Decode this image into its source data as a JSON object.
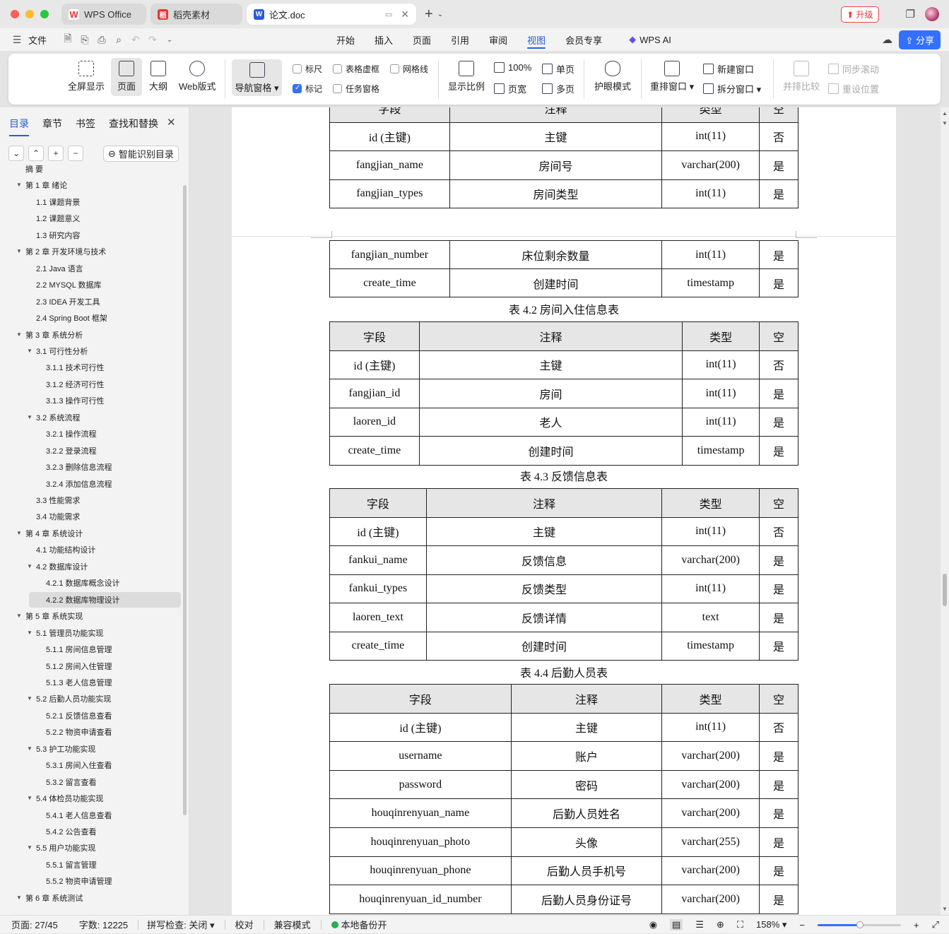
{
  "tabs": [
    {
      "label": "WPS Office"
    },
    {
      "label": "稻壳素材"
    },
    {
      "label": "论文.doc"
    }
  ],
  "title_actions": {
    "upgrade": "升级"
  },
  "menu": {
    "file": "文件",
    "items": [
      "开始",
      "插入",
      "页面",
      "引用",
      "审阅",
      "视图",
      "会员专享"
    ],
    "active": "视图",
    "ai": "WPS AI",
    "share": "分享"
  },
  "ribbon": {
    "fullscreen": "全屏显示",
    "page": "页面",
    "outline": "大纲",
    "web": "Web版式",
    "nav": "导航窗格",
    "ruler": "标尺",
    "table_grid": "表格虚框",
    "gridlines": "网格线",
    "marks": "标记",
    "taskpane": "任务窗格",
    "zoom_ratio": "显示比例",
    "zoom100": "100%",
    "page_width": "页宽",
    "single": "单页",
    "multi": "多页",
    "eye": "护眼模式",
    "rearrange": "重排窗口",
    "new_window": "新建窗口",
    "split": "拆分窗口",
    "compare": "并排比较",
    "sync_scroll": "同步滚动",
    "reset_pos": "重设位置"
  },
  "sidebar": {
    "tabs": [
      "目录",
      "章节",
      "书签",
      "查找和替换"
    ],
    "smart": "智能识别目录",
    "toc": [
      {
        "t": "摘  要",
        "lv": 1
      },
      {
        "t": "第 1 章  绪论",
        "lv": 1,
        "arrow": true
      },
      {
        "t": "1.1  课题背景",
        "lv": 2
      },
      {
        "t": "1.2  课题意义",
        "lv": 2
      },
      {
        "t": "1.3  研究内容",
        "lv": 2
      },
      {
        "t": "第 2 章  开发环境与技术",
        "lv": 1,
        "arrow": true
      },
      {
        "t": "2.1 Java 语言",
        "lv": 2
      },
      {
        "t": "2.2 MYSQL 数据库",
        "lv": 2
      },
      {
        "t": "2.3 IDEA 开发工具",
        "lv": 2
      },
      {
        "t": "2.4 Spring Boot 框架",
        "lv": 2
      },
      {
        "t": "第 3 章  系统分析",
        "lv": 1,
        "arrow": true
      },
      {
        "t": "3.1  可行性分析",
        "lv": 2,
        "arrow": true
      },
      {
        "t": "3.1.1  技术可行性",
        "lv": 3
      },
      {
        "t": "3.1.2  经济可行性",
        "lv": 3
      },
      {
        "t": "3.1.3  操作可行性",
        "lv": 3
      },
      {
        "t": "3.2  系统流程",
        "lv": 2,
        "arrow": true
      },
      {
        "t": "3.2.1  操作流程",
        "lv": 3
      },
      {
        "t": "3.2.2  登录流程",
        "lv": 3
      },
      {
        "t": "3.2.3  删除信息流程",
        "lv": 3
      },
      {
        "t": "3.2.4  添加信息流程",
        "lv": 3
      },
      {
        "t": "3.3  性能需求",
        "lv": 2
      },
      {
        "t": "3.4  功能需求",
        "lv": 2
      },
      {
        "t": "第 4 章  系统设计",
        "lv": 1,
        "arrow": true
      },
      {
        "t": "4.1  功能结构设计",
        "lv": 2
      },
      {
        "t": "4.2  数据库设计",
        "lv": 2,
        "arrow": true
      },
      {
        "t": "4.2.1  数据库概念设计",
        "lv": 3
      },
      {
        "t": "4.2.2  数据库物理设计",
        "lv": 3,
        "hl": true
      },
      {
        "t": "第 5 章  系统实现",
        "lv": 1,
        "arrow": true
      },
      {
        "t": "5.1  管理员功能实现",
        "lv": 2,
        "arrow": true
      },
      {
        "t": "5.1.1  房间信息管理",
        "lv": 3
      },
      {
        "t": "5.1.2  房间入住管理",
        "lv": 3
      },
      {
        "t": "5.1.3  老人信息管理",
        "lv": 3
      },
      {
        "t": "5.2  后勤人员功能实现",
        "lv": 2,
        "arrow": true
      },
      {
        "t": "5.2.1  反馈信息查看",
        "lv": 3
      },
      {
        "t": "5.2.2  物资申请查看",
        "lv": 3
      },
      {
        "t": "5.3  护工功能实现",
        "lv": 2,
        "arrow": true
      },
      {
        "t": "5.3.1  房间入住查看",
        "lv": 3
      },
      {
        "t": "5.3.2  留言查看",
        "lv": 3
      },
      {
        "t": "5.4  体检员功能实现",
        "lv": 2,
        "arrow": true
      },
      {
        "t": "5.4.1  老人信息查看",
        "lv": 3
      },
      {
        "t": "5.4.2  公告查看",
        "lv": 3
      },
      {
        "t": "5.5  用户功能实现",
        "lv": 2,
        "arrow": true
      },
      {
        "t": "5.5.1  留言管理",
        "lv": 3
      },
      {
        "t": "5.5.2  物资申请管理",
        "lv": 3
      },
      {
        "t": "第 6 章  系统测试",
        "lv": 1,
        "arrow": true
      }
    ]
  },
  "doc": {
    "t0_rows": [
      [
        "字段",
        "注释",
        "类型",
        "空"
      ],
      [
        "id (主键)",
        "主键",
        "int(11)",
        "否"
      ],
      [
        "fangjian_name",
        "房间号",
        "varchar(200)",
        "是"
      ],
      [
        "fangjian_types",
        "房间类型",
        "int(11)",
        "是"
      ]
    ],
    "t1_rows": [
      [
        "fangjian_number",
        "床位剩余数量",
        "int(11)",
        "是"
      ],
      [
        "create_time",
        "创建时间",
        "timestamp",
        "是"
      ]
    ],
    "cap2": "表 4.2  房间入住信息表",
    "t2_rows": [
      [
        "字段",
        "注释",
        "类型",
        "空"
      ],
      [
        "id (主键)",
        "主键",
        "int(11)",
        "否"
      ],
      [
        "fangjian_id",
        "房间",
        "int(11)",
        "是"
      ],
      [
        "laoren_id",
        "老人",
        "int(11)",
        "是"
      ],
      [
        "create_time",
        "创建时间",
        "timestamp",
        "是"
      ]
    ],
    "cap3": "表 4.3  反馈信息表",
    "t3_rows": [
      [
        "字段",
        "注释",
        "类型",
        "空"
      ],
      [
        "id (主键)",
        "主键",
        "int(11)",
        "否"
      ],
      [
        "fankui_name",
        "反馈信息",
        "varchar(200)",
        "是"
      ],
      [
        "fankui_types",
        "反馈类型",
        "int(11)",
        "是"
      ],
      [
        "laoren_text",
        "反馈详情",
        "text",
        "是"
      ],
      [
        "create_time",
        "创建时间",
        "timestamp",
        "是"
      ]
    ],
    "cap4": "表 4.4  后勤人员表",
    "t4_rows": [
      [
        "字段",
        "注释",
        "类型",
        "空"
      ],
      [
        "id (主键)",
        "主键",
        "int(11)",
        "否"
      ],
      [
        "username",
        "账户",
        "varchar(200)",
        "是"
      ],
      [
        "password",
        "密码",
        "varchar(200)",
        "是"
      ],
      [
        "houqinrenyuan_name",
        "后勤人员姓名",
        "varchar(200)",
        "是"
      ],
      [
        "houqinrenyuan_photo",
        "头像",
        "varchar(255)",
        "是"
      ],
      [
        "houqinrenyuan_phone",
        "后勤人员手机号",
        "varchar(200)",
        "是"
      ],
      [
        "houqinrenyuan_id_number",
        "后勤人员身份证号",
        "varchar(200)",
        "是"
      ]
    ]
  },
  "status": {
    "page": "页面: 27/45",
    "words": "字数: 12225",
    "spell": "拼写检查: 关闭",
    "proof": "校对",
    "compat": "兼容模式",
    "backup": "本地备份开",
    "zoom": "158%"
  },
  "colors": {
    "accent": "#3370ff",
    "red": "#e33"
  }
}
